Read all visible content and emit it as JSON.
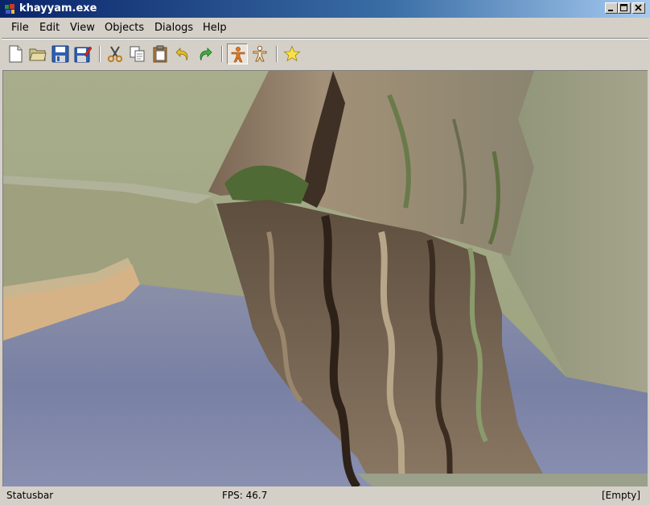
{
  "window": {
    "title": "khayyam.exe",
    "icon": "app-icon",
    "controls": [
      "minimize-icon",
      "maximize-icon",
      "close-icon"
    ]
  },
  "menu": {
    "items": [
      "File",
      "Edit",
      "View",
      "Objects",
      "Dialogs",
      "Help"
    ]
  },
  "toolbar": {
    "buttons": [
      {
        "name": "new-file",
        "icon": "new-file-icon"
      },
      {
        "name": "open-file",
        "icon": "folder-icon"
      },
      {
        "name": "save",
        "icon": "save-icon"
      },
      {
        "name": "save-as",
        "icon": "save-as-icon"
      },
      {
        "name": "cut",
        "icon": "scissors-icon"
      },
      {
        "name": "copy",
        "icon": "copy-icon"
      },
      {
        "name": "paste",
        "icon": "paste-icon"
      },
      {
        "name": "undo",
        "icon": "undo-icon"
      },
      {
        "name": "redo",
        "icon": "redo-icon"
      },
      {
        "name": "character-mode",
        "icon": "person-icon",
        "pressed": true
      },
      {
        "name": "character-outline",
        "icon": "person-outline-icon"
      },
      {
        "name": "favorite",
        "icon": "star-icon"
      }
    ]
  },
  "viewport": {
    "content": "3d-scene",
    "colors": {
      "sky_grass": "#a9ad8a",
      "sand": "#d8b88a",
      "water": "#7c86a6",
      "rock": "#8a7a66"
    }
  },
  "statusbar": {
    "left": "Statusbar",
    "fps": "FPS: 46.7",
    "right": "[Empty]"
  }
}
